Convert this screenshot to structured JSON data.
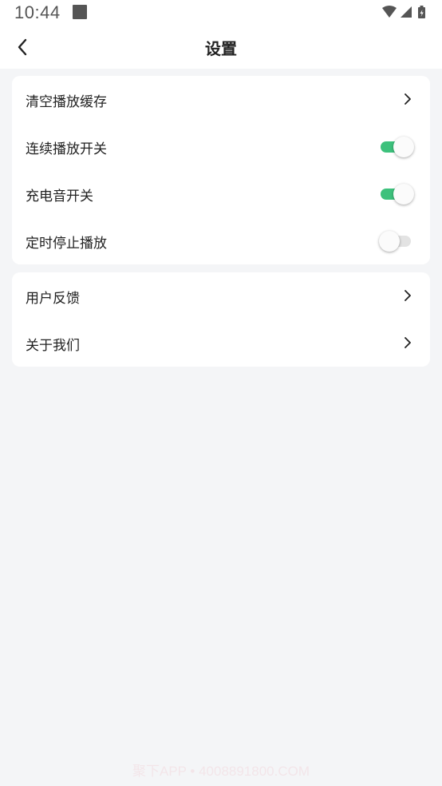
{
  "status_bar": {
    "time": "10:44",
    "icons": [
      "notification-square-icon",
      "wifi-icon",
      "signal-icon",
      "battery-charging-icon"
    ]
  },
  "header": {
    "title": "设置",
    "back_icon": "chevron-left-icon"
  },
  "groups": [
    {
      "items": [
        {
          "label": "清空播放缓存",
          "control": "chevron"
        },
        {
          "label": "连续播放开关",
          "control": "toggle",
          "on": true
        },
        {
          "label": "充电音开关",
          "control": "toggle",
          "on": true
        },
        {
          "label": "定时停止播放",
          "control": "toggle",
          "on": false
        }
      ]
    },
    {
      "items": [
        {
          "label": "用户反馈",
          "control": "chevron"
        },
        {
          "label": "关于我们",
          "control": "chevron"
        }
      ]
    }
  ],
  "colors": {
    "background": "#f4f5f7",
    "card": "#ffffff",
    "toggle_on": "#3dc17c",
    "toggle_off": "#e3e3e3"
  },
  "watermark": "聚下APP • 4008891800.COM"
}
